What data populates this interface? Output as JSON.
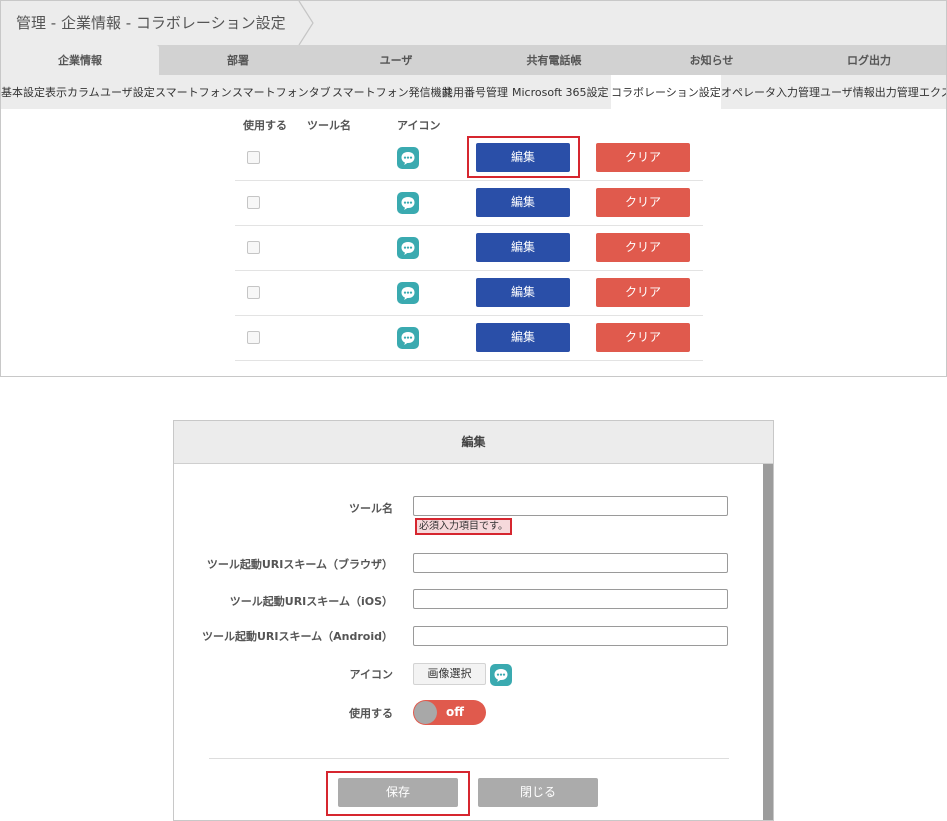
{
  "breadcrumb": {
    "text": "管理 - 企業情報 - コラボレーション設定"
  },
  "main_tabs": [
    {
      "label": "企業情報",
      "active": true
    },
    {
      "label": "部署"
    },
    {
      "label": "ユーザ"
    },
    {
      "label": "共有電話帳"
    },
    {
      "label": "お知らせ"
    },
    {
      "label": "ログ出力"
    }
  ],
  "sub_tabs": [
    {
      "label": "基本設定"
    },
    {
      "label": "表示カラム"
    },
    {
      "label": "ユーザ設定"
    },
    {
      "label": "スマートフォン"
    },
    {
      "label": "スマートフォンタブ"
    },
    {
      "label": "スマートフォン発信機能"
    },
    {
      "label": "共用番号管理"
    },
    {
      "label": "Microsoft 365設定"
    },
    {
      "label": "コラボレーション設定",
      "active": true
    },
    {
      "label": "オペレータ入力管理"
    },
    {
      "label": "ユーザ情報出力管理"
    },
    {
      "label": "エクス"
    }
  ],
  "tool_table": {
    "headers": {
      "use": "使用する",
      "tool_name": "ツール名",
      "icon": "アイコン"
    },
    "rows": [
      {
        "edit": "編集",
        "clear": "クリア",
        "icon": "chat-bubble-icon",
        "checked": false
      },
      {
        "edit": "編集",
        "clear": "クリア",
        "icon": "chat-bubble-icon",
        "checked": false
      },
      {
        "edit": "編集",
        "clear": "クリア",
        "icon": "chat-bubble-icon",
        "checked": false
      },
      {
        "edit": "編集",
        "clear": "クリア",
        "icon": "chat-bubble-icon",
        "checked": false
      },
      {
        "edit": "編集",
        "clear": "クリア",
        "icon": "chat-bubble-icon",
        "checked": false
      }
    ]
  },
  "dialog": {
    "title": "編集",
    "fields": {
      "tool_name": {
        "label": "ツール名",
        "value": ""
      },
      "required_msg": "必須入力項目です。",
      "uri_browser": {
        "label": "ツール起動URIスキーム（ブラウザ）",
        "value": ""
      },
      "uri_ios": {
        "label": "ツール起動URIスキーム（iOS）",
        "value": ""
      },
      "uri_android": {
        "label": "ツール起動URIスキーム（Android）",
        "value": ""
      },
      "icon": {
        "label": "アイコン",
        "button": "画像選択",
        "icon_name": "chat-bubble-icon"
      },
      "use": {
        "label": "使用する",
        "toggle_text": "off"
      }
    },
    "save_label": "保存",
    "close_label": "閉じる"
  },
  "colors": {
    "edit_button": "#2a4fa8",
    "clear_button": "#e05a4d",
    "icon_teal": "#3aaab0",
    "highlight": "#d6262f",
    "toggle_off": "#e05a4d"
  }
}
